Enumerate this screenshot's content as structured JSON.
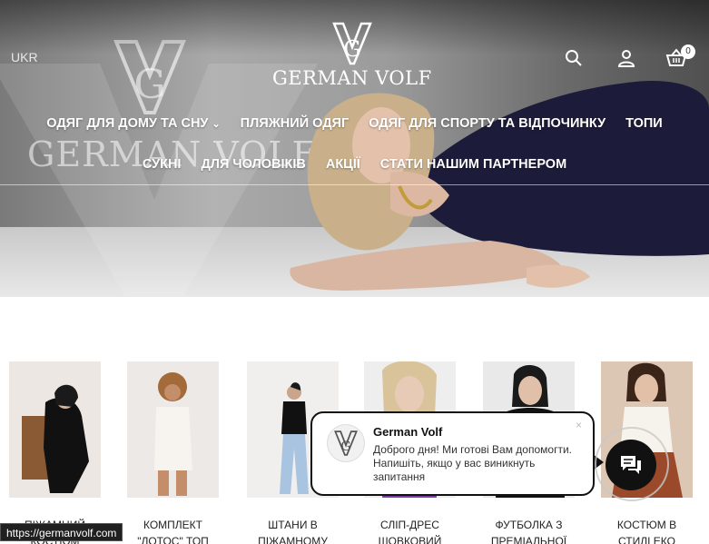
{
  "header": {
    "language": "UKR",
    "brand": "GERMAN VOLF",
    "background_brand": "GERMAN VOLF",
    "cart_count": "0",
    "icons": [
      "search-icon",
      "user-icon",
      "cart-icon"
    ]
  },
  "nav": {
    "row1": [
      "ОДЯГ ДЛЯ ДОМУ ТА СНУ",
      "ПЛЯЖНИЙ ОДЯГ",
      "ОДЯГ ДЛЯ СПОРТУ ТА ВІДПОЧИНКУ",
      "ТОПИ"
    ],
    "row2": [
      "СУКНІ",
      "ДЛЯ ЧОЛОВІКІВ",
      "АКЦІЇ",
      "СТАТИ НАШИМ ПАРТНЕРОМ"
    ]
  },
  "products": [
    {
      "title": "ПІЖАМНИЙ КОСТЮМ"
    },
    {
      "title": "КОМПЛЕКТ \"ЛОТОС\" ТОП"
    },
    {
      "title": "ШТАНИ В ПІЖАМНОМУ"
    },
    {
      "title": "СЛІП-ДРЕС ШОВКОВИЙ"
    },
    {
      "title": "ФУТБОЛКА З ПРЕМІАЛЬНОЇ"
    },
    {
      "title": "КОСТЮМ В СТИЛІ ЕКО"
    }
  ],
  "chat": {
    "name": "German Volf",
    "message": "Доброго дня! Ми готові Вам допомогти. Напишіть, якщо у вас виникнуть запитання",
    "close": "×"
  },
  "status_bar": {
    "url": "https://germanvolf.com"
  },
  "colors": {
    "accent": "#111111",
    "nav_text": "#ffffff"
  }
}
